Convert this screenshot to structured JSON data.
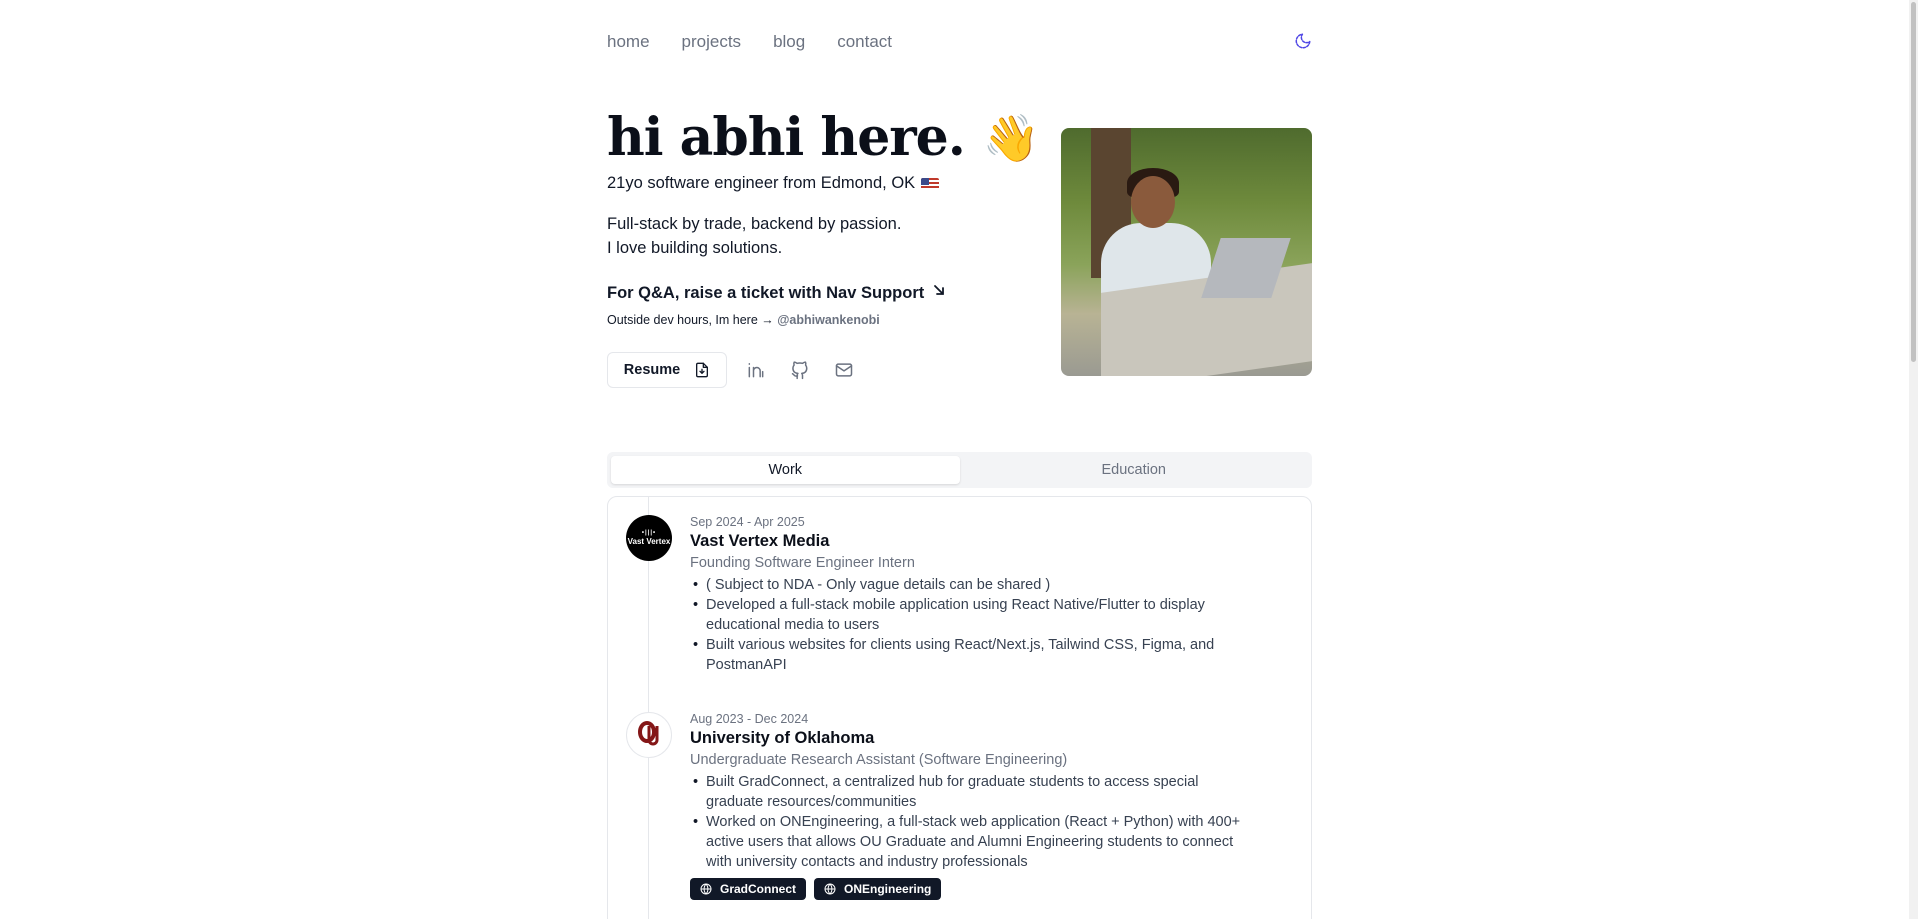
{
  "nav": {
    "items": [
      "home",
      "projects",
      "blog",
      "contact"
    ]
  },
  "hero": {
    "title": "hi abhi here.",
    "wave_emoji": "👋",
    "subtitle": "21yo software engineer from Edmond, OK",
    "flag_icon": "us-flag-icon",
    "intro": "Full-stack by trade, backend by passion. I love building solutions.",
    "qa_text": "For Q&A, raise a ticket with Nav Support",
    "outside_prefix": "Outside dev hours, Im here →",
    "outside_handle": "@abhiwankenobi"
  },
  "actions": {
    "resume_label": "Resume",
    "icons": [
      "file-download-icon",
      "linkedin-icon",
      "github-icon",
      "mail-icon"
    ]
  },
  "tabs": [
    "Work",
    "Education"
  ],
  "work": [
    {
      "dates": "Sep 2024 - Apr 2025",
      "company": "Vast Vertex Media",
      "logo_text": "Vast Vertex",
      "role": "Founding Software Engineer Intern",
      "bullets": [
        "( Subject to NDA - Only vague details can be shared )",
        "Developed a full-stack mobile application using React Native/Flutter to display educational media to users",
        "Built various websites for clients using React/Next.js, Tailwind CSS, Figma, and PostmanAPI"
      ]
    },
    {
      "dates": "Aug 2023 - Dec 2024",
      "company": "University of Oklahoma",
      "role": "Undergraduate Research Assistant (Software Engineering)",
      "bullets": [
        "Built GradConnect, a centralized hub for graduate students to access special graduate resources/communities",
        "Worked on ONEngineering, a full-stack web application (React + Python) with 400+ active users that allows OU Graduate and Alumni Engineering students to connect with university contacts and industry professionals"
      ],
      "badges": [
        "GradConnect",
        "ONEngineering"
      ]
    }
  ],
  "colors": {
    "text": "#111827",
    "muted": "#6b7280",
    "ou_crimson": "#841617",
    "badge_bg": "#111827"
  }
}
